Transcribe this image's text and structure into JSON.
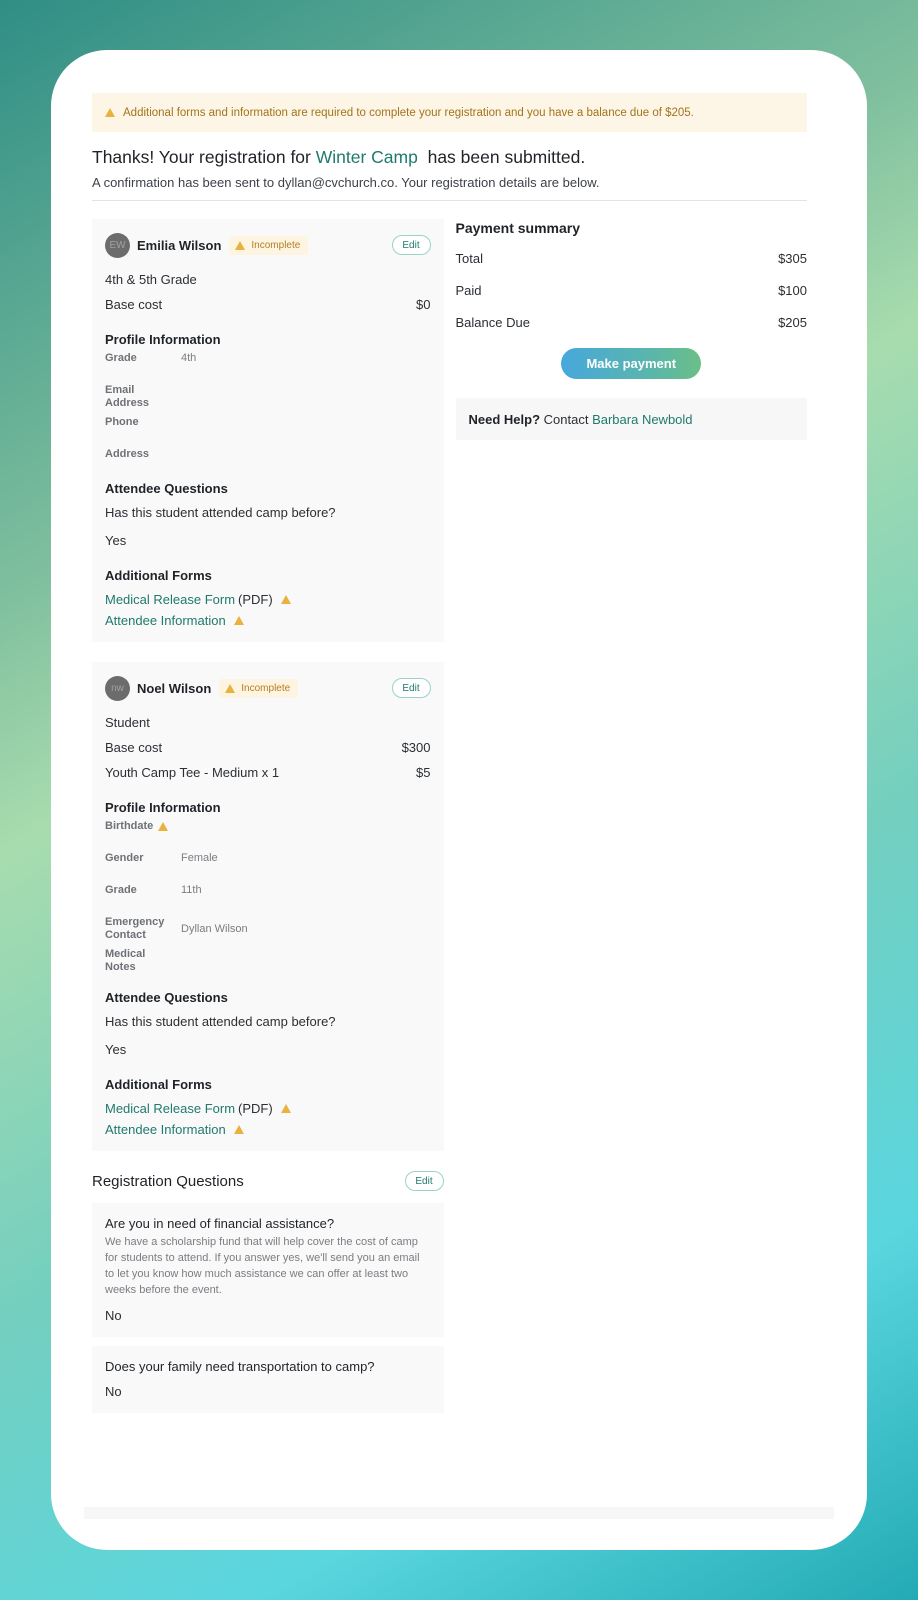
{
  "alert": {
    "icon": "warning-icon",
    "text": "Additional forms and information are required to complete your registration and you have a balance due of $205."
  },
  "headline": {
    "prefix": "Thanks! Your registration for",
    "event": "Winter Camp",
    "suffix": "has been submitted."
  },
  "confirmation": "A confirmation has been sent to dyllan@cvchurch.co. Your registration details are below.",
  "attendees": [
    {
      "initials": "EW",
      "name": "Emilia Wilson",
      "status": "Incomplete",
      "edit_label": "Edit",
      "group": "4th & 5th Grade",
      "line_items": [
        {
          "label": "Base cost",
          "amount": "$0"
        }
      ],
      "profile_title": "Profile Information",
      "profile": [
        {
          "label": "Grade",
          "value": "4th"
        },
        {
          "label": "Email Address",
          "value": ""
        },
        {
          "label": "Phone",
          "value": ""
        },
        {
          "label": "Address",
          "value": ""
        }
      ],
      "questions_title": "Attendee Questions",
      "question": "Has this student attended camp before?",
      "answer": "Yes",
      "forms_title": "Additional Forms",
      "forms": [
        {
          "label": "Medical Release Form",
          "suffix": "(PDF)"
        },
        {
          "label": "Attendee Information",
          "suffix": ""
        }
      ]
    },
    {
      "initials": "nw",
      "name": "Noel Wilson",
      "status": "Incomplete",
      "edit_label": "Edit",
      "group": "Student",
      "line_items": [
        {
          "label": "Base cost",
          "amount": "$300"
        },
        {
          "label": "Youth Camp Tee - Medium x 1",
          "amount": "$5"
        }
      ],
      "profile_title": "Profile Information",
      "profile": [
        {
          "label": "Birthdate",
          "value": "",
          "warn": true
        },
        {
          "label": "Gender",
          "value": "Female"
        },
        {
          "label": "Grade",
          "value": "11th"
        },
        {
          "label": "Emergency Contact",
          "value": "Dyllan Wilson"
        },
        {
          "label": "Medical Notes",
          "value": ""
        }
      ],
      "questions_title": "Attendee Questions",
      "question": "Has this student attended camp before?",
      "answer": "Yes",
      "forms_title": "Additional Forms",
      "forms": [
        {
          "label": "Medical Release Form",
          "suffix": "(PDF)"
        },
        {
          "label": "Attendee Information",
          "suffix": ""
        }
      ]
    }
  ],
  "registration_questions": {
    "title": "Registration Questions",
    "edit_label": "Edit",
    "items": [
      {
        "question": "Are you in need of financial assistance?",
        "description": "We have a scholarship fund that will help cover the cost of camp for students to attend. If you answer yes, we'll send you an email to let you know how much assistance we can offer at least two weeks before the event.",
        "answer": "No"
      },
      {
        "question": "Does your family need transportation to camp?",
        "description": "",
        "answer": "No"
      }
    ]
  },
  "payment": {
    "title": "Payment summary",
    "rows": [
      {
        "label": "Total",
        "value": "$305"
      },
      {
        "label": "Paid",
        "value": "$100"
      },
      {
        "label": "Balance Due",
        "value": "$205"
      }
    ],
    "button_label": "Make payment"
  },
  "help": {
    "bold": "Need Help?",
    "text": "Contact",
    "contact_name": "Barbara Newbold"
  },
  "colors": {
    "accent": "#1f7a6e",
    "warning": "#e9b23e",
    "alert_bg": "#fdf5e6"
  }
}
